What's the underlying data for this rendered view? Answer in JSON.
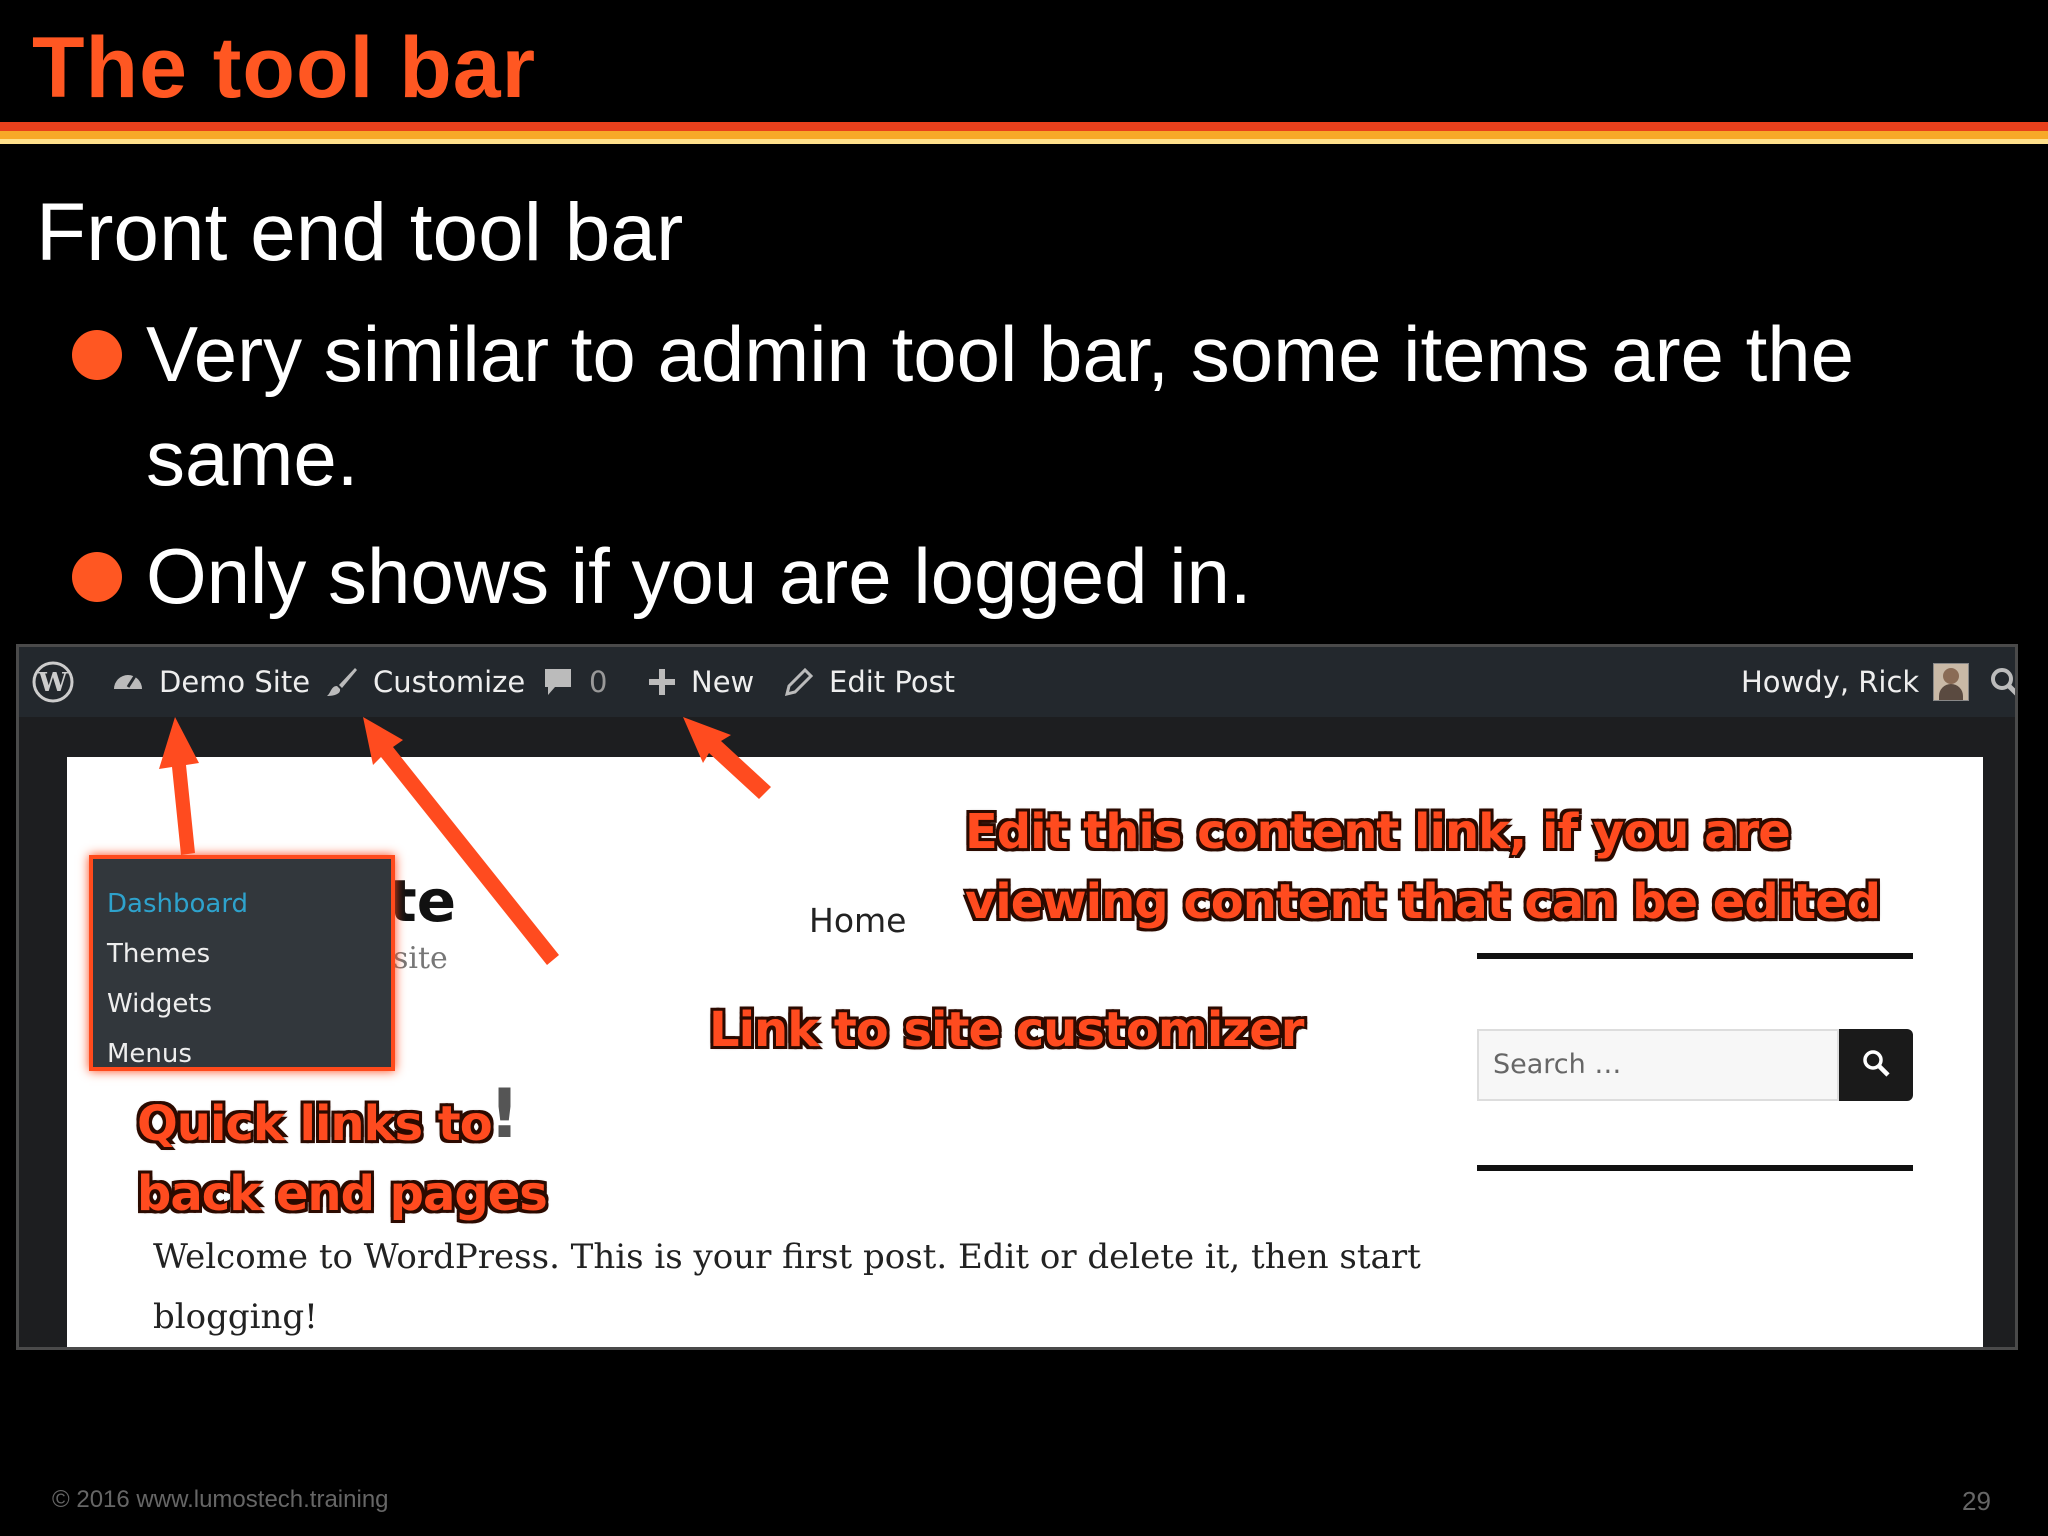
{
  "slide": {
    "title": "The tool bar",
    "heading": "Front end tool bar",
    "bullets": [
      "Very similar to admin tool bar, some items are the same.",
      "Only shows if you are logged in."
    ],
    "accent_color": "#ff5722"
  },
  "screenshot": {
    "adminbar": {
      "site_label": "Demo Site",
      "customize_label": "Customize",
      "comments_count": "0",
      "new_label": "New",
      "edit_label": "Edit Post",
      "account_label": "Howdy, Rick",
      "icons": [
        "wordpress-icon",
        "dashboard-icon",
        "paintbrush-icon",
        "comment-icon",
        "plus-icon",
        "pencil-icon",
        "avatar",
        "search-icon"
      ]
    },
    "dropdown": [
      "Dashboard",
      "Themes",
      "Widgets",
      "Menus"
    ],
    "page": {
      "site_title_fragment": "te",
      "site_desc_fragment": "site",
      "nav_home": "Home",
      "post_title_fragment": "!",
      "body_line1": "Welcome to WordPress. This is your first post. Edit or delete it, then start",
      "body_line2": "blogging!",
      "search_placeholder": "Search …"
    },
    "callouts": {
      "edit": [
        "Edit this content link, if you are",
        "viewing content that can be edited"
      ],
      "customizer": "Link to site customizer",
      "quick": [
        "Quick links to",
        "back end pages"
      ]
    }
  },
  "footer": {
    "copyright": "© 2016  www.lumostech.training",
    "page_number": "29"
  }
}
